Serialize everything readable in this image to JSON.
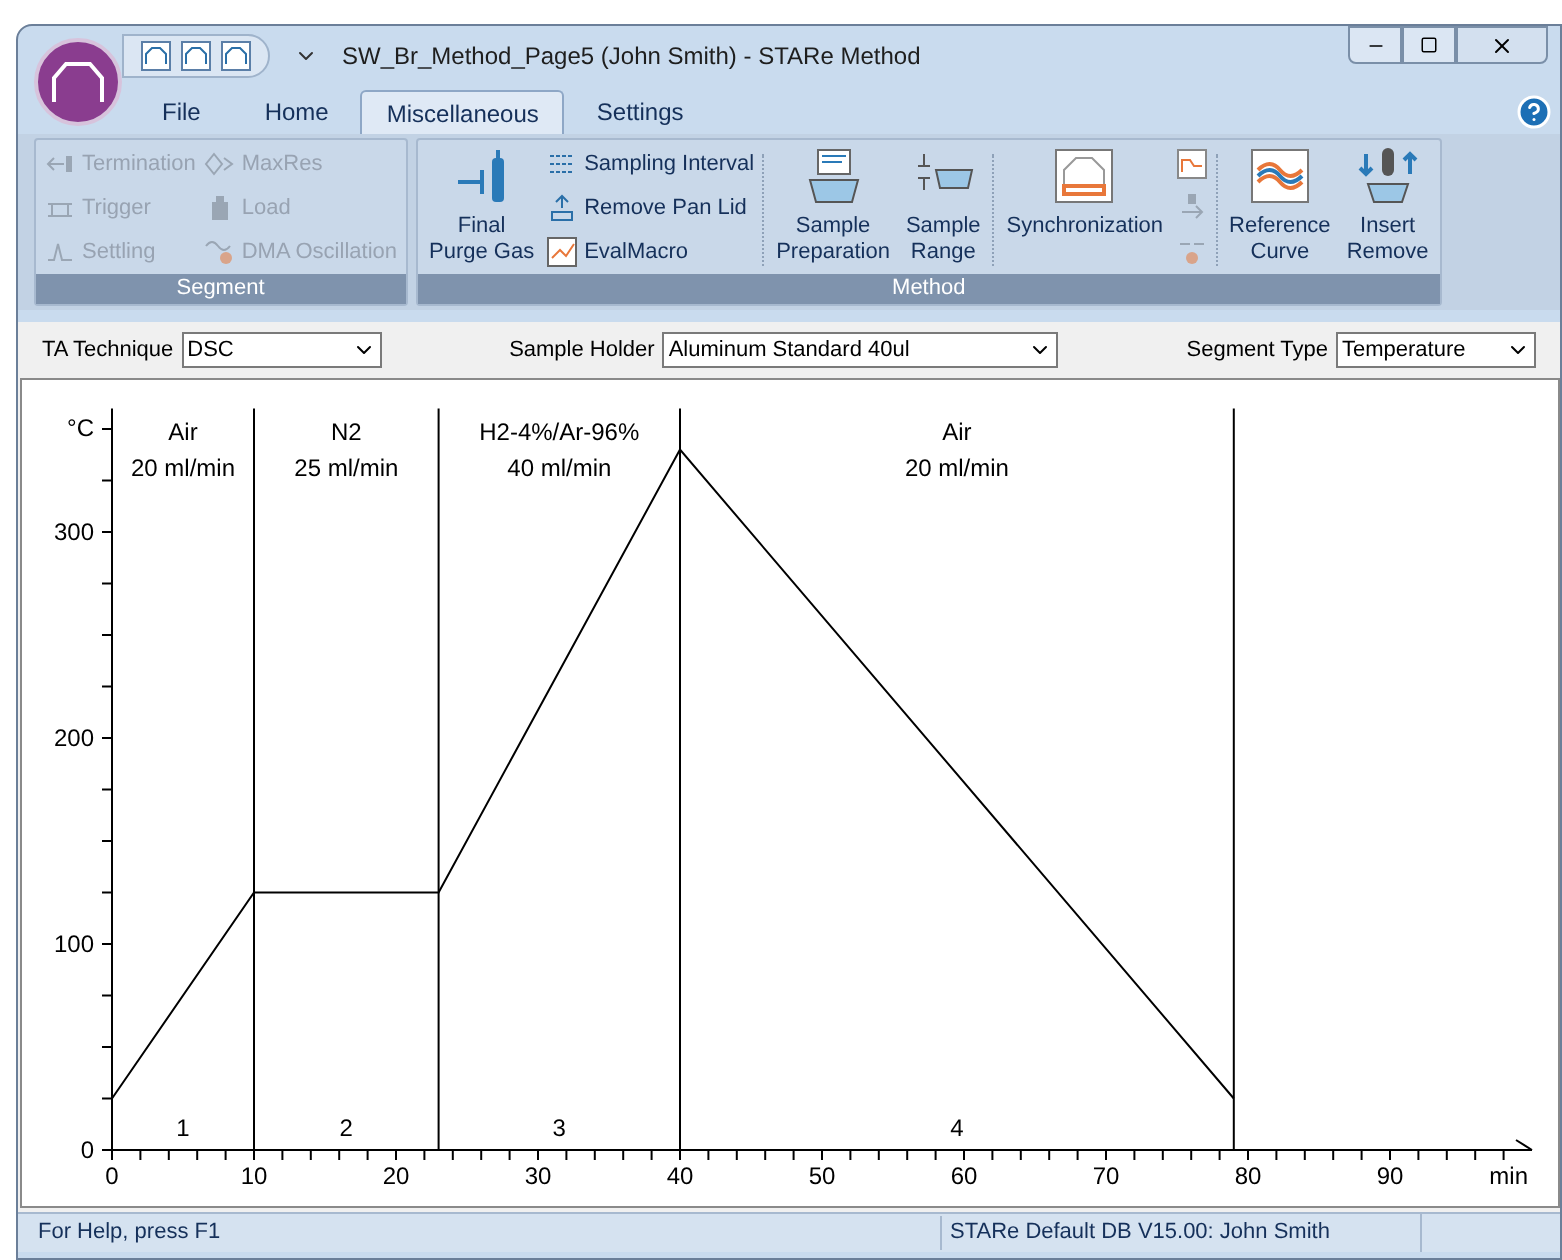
{
  "window": {
    "title": "SW_Br_Method_Page5 (John Smith) - STARe Method"
  },
  "ribbon_tabs": [
    {
      "label": "File",
      "selected": false
    },
    {
      "label": "Home",
      "selected": false
    },
    {
      "label": "Miscellaneous",
      "selected": true
    },
    {
      "label": "Settings",
      "selected": false
    }
  ],
  "ribbon_groups": [
    {
      "title": "Segment",
      "columns": [
        {
          "kind": "small",
          "items": [
            {
              "label": "Termination",
              "disabled": true
            },
            {
              "label": "Trigger",
              "disabled": true
            },
            {
              "label": "Settling",
              "disabled": true
            }
          ]
        },
        {
          "kind": "small",
          "items": [
            {
              "label": "MaxRes",
              "disabled": true
            },
            {
              "label": "Load",
              "disabled": true
            },
            {
              "label": "DMA Oscillation",
              "disabled": true
            }
          ]
        }
      ]
    },
    {
      "title": "Method",
      "columns": [
        {
          "kind": "large",
          "label": "Final\nPurge Gas",
          "disabled": false
        },
        {
          "kind": "small",
          "items": [
            {
              "label": "Sampling Interval",
              "disabled": false
            },
            {
              "label": "Remove Pan Lid",
              "disabled": false
            },
            {
              "label": "EvalMacro",
              "disabled": false
            }
          ]
        },
        {
          "kind": "separator"
        },
        {
          "kind": "large",
          "label": "Sample\nPreparation",
          "disabled": false
        },
        {
          "kind": "large",
          "label": "Sample\nRange",
          "disabled": false
        },
        {
          "kind": "separator"
        },
        {
          "kind": "large",
          "label": "Synchronization",
          "disabled": false
        },
        {
          "kind": "small",
          "items": [
            {
              "disabled": false
            },
            {
              "disabled": true
            },
            {
              "disabled": true
            }
          ]
        },
        {
          "kind": "separator"
        },
        {
          "kind": "large",
          "label": "Reference\nCurve",
          "disabled": false
        },
        {
          "kind": "large",
          "label": "Insert\nRemove",
          "disabled": false
        }
      ]
    }
  ],
  "toolbar": [
    {
      "label": "TA Technique",
      "value": "DSC"
    },
    {
      "label": "Sample Holder",
      "value": "Aluminum Standard 40ul"
    },
    {
      "label": "Segment Type",
      "value": "Temperature"
    }
  ],
  "segments": [
    {
      "gas": "Air",
      "flow": "20 ml/min",
      "number": "1"
    },
    {
      "gas": "N2",
      "flow": "25 ml/min",
      "number": "2"
    },
    {
      "gas": "H2-4%/Ar-96%",
      "flow": "40 ml/min",
      "number": "3"
    },
    {
      "gas": "Air",
      "flow": "20 ml/min",
      "number": "4"
    }
  ],
  "chart_data": {
    "type": "line",
    "xlabel": "min",
    "ylabel": "°C",
    "x": [
      0,
      10,
      23,
      40,
      79
    ],
    "values": [
      25,
      125,
      125,
      340,
      25
    ],
    "xlim": [
      0,
      100
    ],
    "ylim": [
      0,
      360
    ],
    "xticks": [
      0,
      10,
      20,
      30,
      40,
      50,
      60,
      70,
      80,
      90
    ],
    "yticks": [
      0,
      100,
      200,
      300
    ]
  },
  "status_bar": [
    "For Help, press F1",
    "STARe Default DB V15.00: John Smith"
  ]
}
